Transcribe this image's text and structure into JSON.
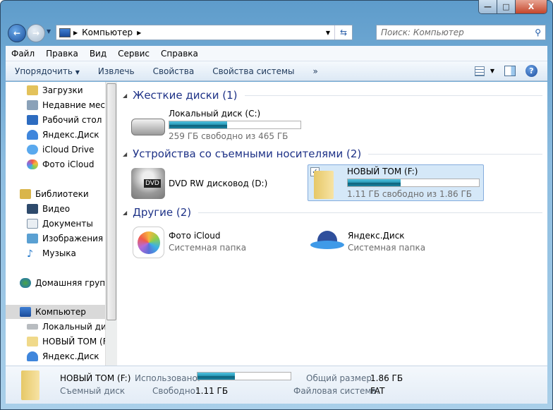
{
  "window": {
    "minimize": "—",
    "maximize": "□",
    "close": "X"
  },
  "address": {
    "path": "Компьютер",
    "search_placeholder": "Поиск: Компьютер"
  },
  "menu": [
    "Файл",
    "Правка",
    "Вид",
    "Сервис",
    "Справка"
  ],
  "toolbar": {
    "organize": "Упорядочить",
    "eject": "Извлечь",
    "properties": "Свойства",
    "system_properties": "Свойства системы",
    "more": "»"
  },
  "sidebar": [
    {
      "label": "Загрузки",
      "icon": "downloads-icon"
    },
    {
      "label": "Недавние места",
      "icon": "recent-places-icon"
    },
    {
      "label": "Рабочий стол",
      "icon": "desktop-icon"
    },
    {
      "label": "Яндекс.Диск",
      "icon": "yandex-disk-icon"
    },
    {
      "label": "iCloud Drive",
      "icon": "icloud-icon"
    },
    {
      "label": "Фото iCloud",
      "icon": "photos-icon"
    },
    {
      "label": "Библиотеки",
      "icon": "libraries-icon"
    },
    {
      "label": "Видео",
      "icon": "video-icon"
    },
    {
      "label": "Документы",
      "icon": "documents-icon"
    },
    {
      "label": "Изображения",
      "icon": "pictures-icon"
    },
    {
      "label": "Музыка",
      "icon": "music-icon"
    },
    {
      "label": "Домашняя группа",
      "icon": "homegroup-icon"
    },
    {
      "label": "Компьютер",
      "icon": "computer-icon"
    },
    {
      "label": "Локальный диск (C:)",
      "icon": "drive-icon"
    },
    {
      "label": "НОВЫЙ ТОМ (F:)",
      "icon": "usb-drive-icon"
    },
    {
      "label": "Яндекс.Диск",
      "icon": "yandex-disk-icon"
    }
  ],
  "groups": {
    "hdd": {
      "title": "Жесткие диски (1)",
      "items": [
        {
          "name": "Локальный диск (C:)",
          "info": "259 ГБ свободно из 465 ГБ",
          "used_fraction": 0.443
        }
      ]
    },
    "removable": {
      "title": "Устройства со съемными носителями (2)",
      "items": [
        {
          "name": "DVD RW дисковод (D:)"
        },
        {
          "name": "НОВЫЙ ТОМ (F:)",
          "info": "1.11 ГБ свободно из 1.86 ГБ",
          "used_fraction": 0.403,
          "selected": true
        }
      ]
    },
    "other": {
      "title": "Другие (2)",
      "items": [
        {
          "name": "Фото iCloud",
          "info": "Системная папка"
        },
        {
          "name": "Яндекс.Диск",
          "info": "Системная папка"
        }
      ]
    }
  },
  "status": {
    "name": "НОВЫЙ ТОМ (F:)",
    "type": "Съемный диск",
    "used_label": "Использовано:",
    "used_fraction": 0.403,
    "free_label": "Свободно:",
    "free": "1.11 ГБ",
    "total_label": "Общий размер:",
    "total": "1.86 ГБ",
    "fs_label": "Файловая система:",
    "fs": "FAT"
  },
  "colors": {
    "group_header": "#1e3287",
    "bar_fill": "#1b84a3",
    "selection": "#cce4f7"
  }
}
